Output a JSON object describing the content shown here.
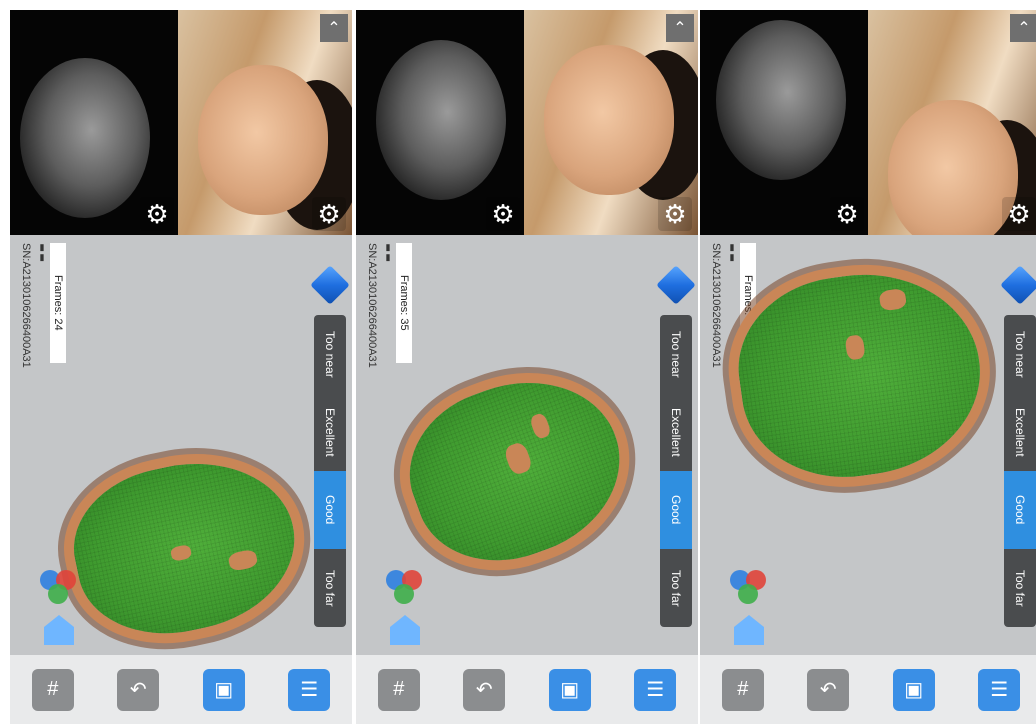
{
  "panels": [
    {
      "frames_label": "Frames: 24",
      "sn_label": "SN:A2130106266400A31",
      "quality": [
        "Too near",
        "Excellent",
        "Good",
        "Too far"
      ],
      "active_quality": "Good"
    },
    {
      "frames_label": "Frames: 35",
      "sn_label": "SN:A2130106266400A31",
      "quality": [
        "Too near",
        "Excellent",
        "Good",
        "Too far"
      ],
      "active_quality": "Good"
    },
    {
      "frames_label": "Frames: 81",
      "sn_label": "SN:A2130106266400A31",
      "quality": [
        "Too near",
        "Excellent",
        "Good",
        "Too far"
      ],
      "active_quality": "Good"
    }
  ],
  "icons": {
    "settings": "gear-icon",
    "collapse": "chevron-up-icon",
    "view_mode": "cube-icon",
    "color_mode": "rgb-circles-icon",
    "home": "home-icon",
    "grid": "grid-icon",
    "undo": "undo-icon",
    "scan": "scan-icon",
    "menu": "menu-icon"
  },
  "colors": {
    "accent": "#2f8fe0",
    "mesh_green": "#3f9b2f",
    "mesh_skin": "#c98657"
  }
}
